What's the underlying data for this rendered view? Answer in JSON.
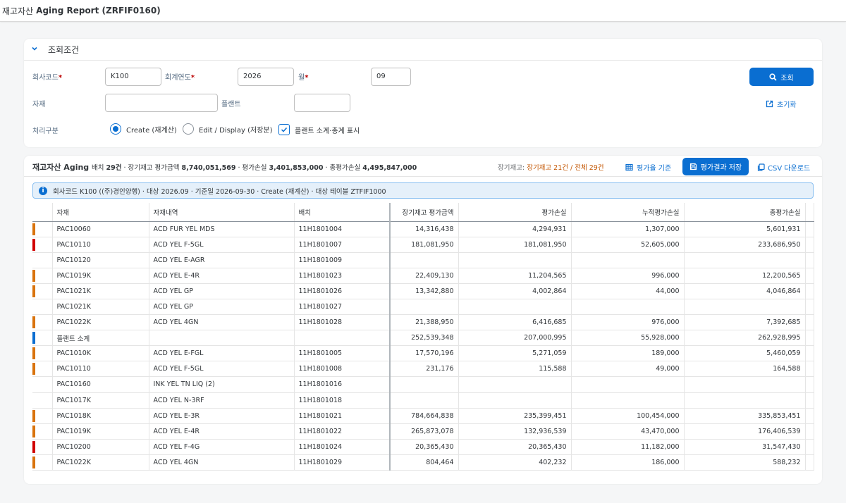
{
  "app": {
    "title_prefix": "재고자산",
    "title_main": "Aging Report (ZRFIF0160)"
  },
  "filter": {
    "header": "조회조건",
    "company_code_label": "회사코드",
    "company_code_value": "K100",
    "fiscal_year_label": "회계연도",
    "fiscal_year_value": "2026",
    "month_label": "월",
    "month_value": "09",
    "material_label": "자재",
    "material_value": "",
    "plant_label": "플랜트",
    "plant_value": "",
    "process_label": "처리구분",
    "option_create": "Create (재계산)",
    "option_edit": "Edit / Display (저장분)",
    "checkbox_label": "플랜트 소계·총계 표시",
    "required_mark": "*",
    "search_button": "조회",
    "reset_button": "초기화"
  },
  "result": {
    "title": "재고자산 Aging",
    "summary_batch_label": "배치",
    "summary_batch_value": "29건",
    "summary_amount_label": "· 장기재고 평가금액",
    "summary_amount_value": "8,740,051,569",
    "summary_loss_label": "· 평가손실",
    "summary_loss_value": "3,401,853,000",
    "summary_total_label": "· 총평가손실",
    "summary_total_value": "4,495,847,000",
    "count_prefix": "장기재고:",
    "count_value": "장기재고 21건 / 전체 29건",
    "btn_basis": "평가율 기준",
    "btn_save": "평가결과 저장",
    "btn_csv": "CSV 다운로드",
    "info": "회사코드 K100 ((주)경인양행) · 대상 2026.09 · 기준일 2026-09-30 · Create (재계산) · 대상 테이블 ZTFIF1000"
  },
  "table": {
    "columns": [
      "자재",
      "자재내역",
      "배치",
      "장기재고 평가금액",
      "평가손실",
      "누적평가손실",
      "총평가손실"
    ],
    "rows": [
      {
        "ind": "#d9730d",
        "c": [
          "PAC10060",
          "ACD FUR YEL MDS",
          "11H1801004",
          "14,316,438",
          "4,294,931",
          "1,307,000",
          "5,601,931"
        ]
      },
      {
        "ind": "#d10000",
        "c": [
          "PAC10110",
          "ACD YEL F-5GL",
          "11H1801007",
          "181,081,950",
          "181,081,950",
          "52,605,000",
          "233,686,950"
        ]
      },
      {
        "ind": "",
        "c": [
          "PAC10120",
          "ACD YEL E-AGR",
          "11H1801009",
          "",
          "",
          "",
          ""
        ]
      },
      {
        "ind": "#d9730d",
        "c": [
          "PAC1019K",
          "ACD YEL E-4R",
          "11H1801023",
          "22,409,130",
          "11,204,565",
          "996,000",
          "12,200,565"
        ]
      },
      {
        "ind": "#d9730d",
        "c": [
          "PAC1021K",
          "ACD YEL GP",
          "11H1801026",
          "13,342,880",
          "4,002,864",
          "44,000",
          "4,046,864"
        ]
      },
      {
        "ind": "",
        "c": [
          "PAC1021K",
          "ACD YEL GP",
          "11H1801027",
          "",
          "",
          "",
          ""
        ]
      },
      {
        "ind": "#d9730d",
        "c": [
          "PAC1022K",
          "ACD YEL 4GN",
          "11H1801028",
          "21,388,950",
          "6,416,685",
          "976,000",
          "7,392,685"
        ]
      },
      {
        "ind": "#0a6ed1",
        "c": [
          "플랜트 소계",
          "",
          "",
          "252,539,348",
          "207,000,995",
          "55,928,000",
          "262,928,995"
        ]
      },
      {
        "ind": "#d9730d",
        "c": [
          "PAC1010K",
          "ACD YEL E-FGL",
          "11H1801005",
          "17,570,196",
          "5,271,059",
          "189,000",
          "5,460,059"
        ]
      },
      {
        "ind": "#d9730d",
        "c": [
          "PAC10110",
          "ACD YEL F-5GL",
          "11H1801008",
          "231,176",
          "115,588",
          "49,000",
          "164,588"
        ]
      },
      {
        "ind": "",
        "c": [
          "PAC10160",
          "INK YEL TN LIQ (2)",
          "11H1801016",
          "",
          "",
          "",
          ""
        ]
      },
      {
        "ind": "",
        "c": [
          "PAC1017K",
          "ACD YEL N-3RF",
          "11H1801018",
          "",
          "",
          "",
          ""
        ]
      },
      {
        "ind": "#d9730d",
        "c": [
          "PAC1018K",
          "ACD YEL E-3R",
          "11H1801021",
          "784,664,838",
          "235,399,451",
          "100,454,000",
          "335,853,451"
        ]
      },
      {
        "ind": "#d9730d",
        "c": [
          "PAC1019K",
          "ACD YEL E-4R",
          "11H1801022",
          "265,873,078",
          "132,936,539",
          "43,470,000",
          "176,406,539"
        ]
      },
      {
        "ind": "#d10000",
        "c": [
          "PAC10200",
          "ACD YEL F-4G",
          "11H1801024",
          "20,365,430",
          "20,365,430",
          "11,182,000",
          "31,547,430"
        ]
      },
      {
        "ind": "#d9730d",
        "c": [
          "PAC1022K",
          "ACD YEL 4GN",
          "11H1801029",
          "804,464",
          "402,232",
          "186,000",
          "588,232"
        ]
      }
    ]
  },
  "colors": {
    "accent": "#0a6ed1",
    "warning": "#d9730d",
    "error": "#d10000"
  }
}
